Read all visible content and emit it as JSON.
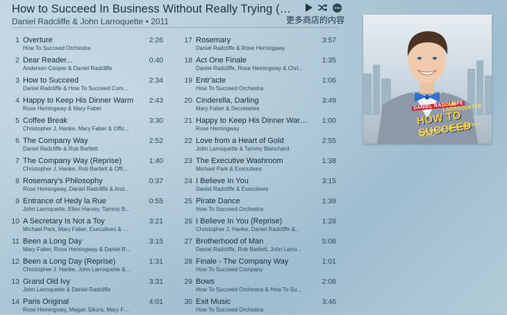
{
  "album": {
    "title": "How to Succeed In Business Without Really Trying (The Musi...",
    "subtitle": "Daniel Radcliffe & John Larroquette • 2011"
  },
  "store_link": "更多商店的内容",
  "icons": {
    "play": "play-icon",
    "shuffle": "shuffle-icon",
    "more": "more-icon"
  },
  "artwork": {
    "name1": "DANIEL RADCLIFFE",
    "name2": "JOHN LARROQUETTE",
    "title_line": "HOW TO SUCCEED",
    "subtitle_line": "IN BUSINESS WITHOUT REALLY TRYING"
  },
  "tracks_left": [
    {
      "num": "1",
      "title": "Overture",
      "artist": "How To Succeed Orchestra",
      "time": "2:26"
    },
    {
      "num": "2",
      "title": "Dear Reader...",
      "artist": "Anderson Cooper & Daniel Radcliffe",
      "time": "0:40"
    },
    {
      "num": "3",
      "title": "How to Succeed",
      "artist": "Daniel Radcliffe & How To Succeed Com...",
      "time": "2:34"
    },
    {
      "num": "4",
      "title": "Happy to Keep His Dinner Warm",
      "artist": "Rose Hemingway & Mary Faber",
      "time": "2:43"
    },
    {
      "num": "5",
      "title": "Coffee Break",
      "artist": "Christopher J. Hanke, Mary Faber & Offic...",
      "time": "3:30"
    },
    {
      "num": "6",
      "title": "The Company Way",
      "artist": "Daniel Radcliffe & Rob Bartlett",
      "time": "2:52"
    },
    {
      "num": "7",
      "title": "The Company Way (Reprise)",
      "artist": "Christopher J. Hanke, Rob Bartlett & Offi...",
      "time": "1:40"
    },
    {
      "num": "8",
      "title": "Rosemary's Philosophy",
      "artist": "Rose Hemingway, Daniel Radcliffe & And...",
      "time": "0:37"
    },
    {
      "num": "9",
      "title": "Entrance of Hedy la Rue",
      "artist": "John Larroquette, Ellen Harvey, Tammy B...",
      "time": "0:55"
    },
    {
      "num": "10",
      "title": "A Secretary Is Not a Toy",
      "artist": "Michael Park, Mary Faber, Executives & S...",
      "time": "3:21"
    },
    {
      "num": "11",
      "title": "Been a Long Day",
      "artist": "Mary Faber, Rose Hemingway & Daniel R...",
      "time": "3:15"
    },
    {
      "num": "12",
      "title": "Been a Long Day (Reprise)",
      "artist": "Christopher J. Hanke, John Larroquette &...",
      "time": "1:31"
    },
    {
      "num": "13",
      "title": "Grand Old Ivy",
      "artist": "John Larroquette & Daniel Radcliffe",
      "time": "3:31"
    },
    {
      "num": "14",
      "title": "Paris Original",
      "artist": "Rose Hemingway, Megan Sikora, Mary Fa...",
      "time": "4:01"
    }
  ],
  "tracks_right": [
    {
      "num": "17",
      "title": "Rosemary",
      "artist": "Daniel Radcliffe & Rose Hemingway",
      "time": "3:57"
    },
    {
      "num": "18",
      "title": "Act One Finale",
      "artist": "Daniel Radcliffe, Rose Hemingway & Chri...",
      "time": "1:35"
    },
    {
      "num": "19",
      "title": "Entr'acte",
      "artist": "How To Succeed Orchestra",
      "time": "1:06"
    },
    {
      "num": "20",
      "title": "Cinderella, Darling",
      "artist": "Mary Faber & Secretaries",
      "time": "3:49"
    },
    {
      "num": "21",
      "title": "Happy to Keep His Dinner Warm...",
      "artist": "Rose Hemingway",
      "time": "1:00"
    },
    {
      "num": "22",
      "title": "Love from a Heart of Gold",
      "artist": "John Larroquette & Tammy Blanchard",
      "time": "2:55"
    },
    {
      "num": "23",
      "title": "The Executive Washroom",
      "artist": "Michael Park & Executives",
      "time": "1:38"
    },
    {
      "num": "24",
      "title": "I Believe In You",
      "artist": "Daniel Radcliffe & Executives",
      "time": "3:15"
    },
    {
      "num": "25",
      "title": "Pirate Dance",
      "artist": "How To Succeed Orchestra",
      "time": "1:39"
    },
    {
      "num": "26",
      "title": "I Believe In You (Reprise)",
      "artist": "Christopher J. Hanke, Daniel Radcliffe &...",
      "time": "1:28"
    },
    {
      "num": "27",
      "title": "Brotherhood of Man",
      "artist": "Daniel Radcliffe, Rob Bartlett, John Larro...",
      "time": "5:08"
    },
    {
      "num": "28",
      "title": "Finale - The Company Way",
      "artist": "How To Succeed Company",
      "time": "1:01"
    },
    {
      "num": "29",
      "title": "Bows",
      "artist": "How To Succeed Orchestra & How To Su...",
      "time": "2:08"
    },
    {
      "num": "30",
      "title": "Exit Music",
      "artist": "How To Succeed Orchestra",
      "time": "3:46"
    }
  ]
}
